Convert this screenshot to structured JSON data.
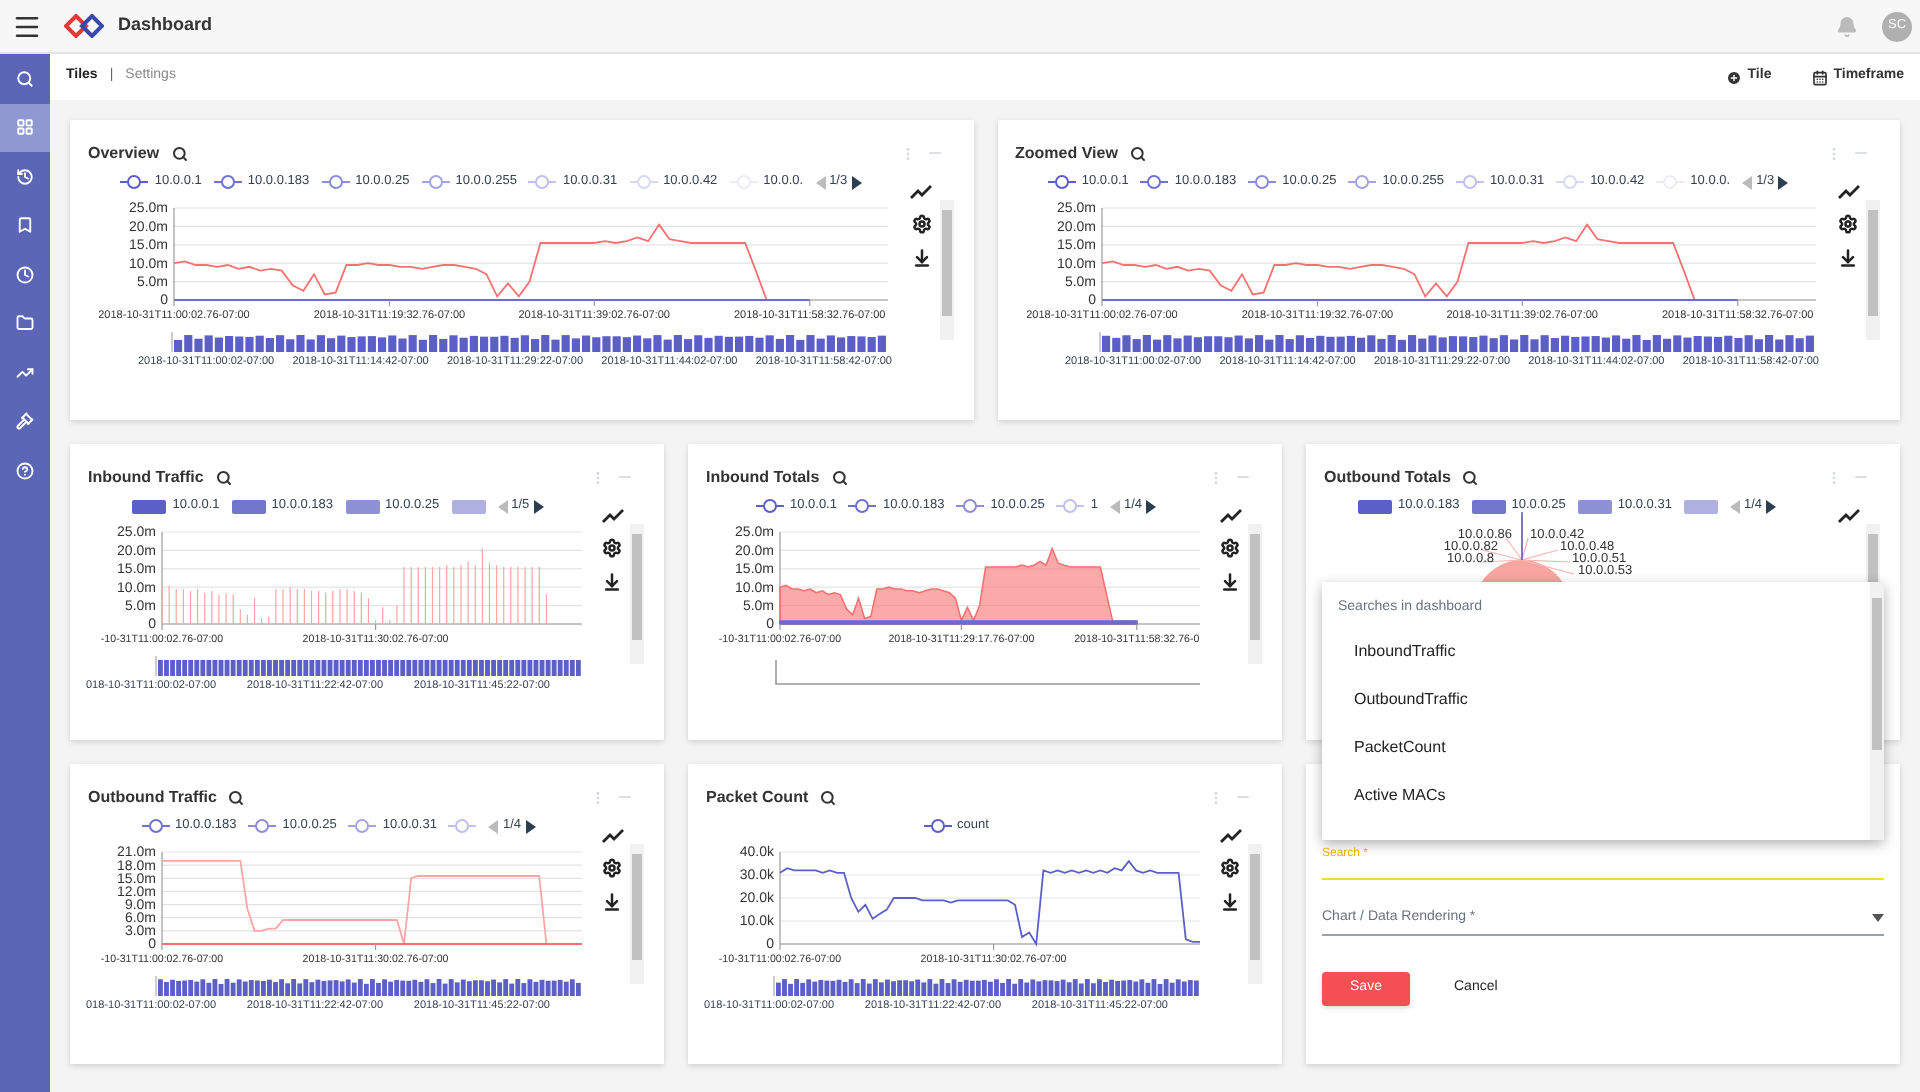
{
  "header": {
    "title": "Dashboard",
    "avatar": "SC"
  },
  "sidebar": {
    "items": [
      {
        "selected": false
      },
      {
        "selected": true
      },
      {
        "selected": false
      },
      {
        "selected": false
      },
      {
        "selected": false
      },
      {
        "selected": false
      },
      {
        "selected": false
      },
      {
        "selected": false
      },
      {
        "selected": false
      }
    ]
  },
  "tabs": [
    {
      "label": "Tiles",
      "selected": true
    },
    {
      "label": "Settings",
      "selected": false
    }
  ],
  "tab_separator": "|",
  "actions": [
    {
      "label": "Tile"
    },
    {
      "label": "Timeframe"
    }
  ],
  "tiles": [
    {
      "kind": "chart",
      "title": "Overview",
      "legend": {
        "kind": "line",
        "items": [
          {
            "label": "10.0.0.1",
            "color": "#5c5fc8"
          },
          {
            "label": "10.0.0.183",
            "color": "#6f72d0"
          },
          {
            "label": "10.0.0.25",
            "color": "#8b8dd9"
          },
          {
            "label": "10.0.0.255",
            "color": "#a3a5e2"
          },
          {
            "label": "10.0.0.31",
            "color": "#bfc0eb"
          },
          {
            "label": "10.0.0.42",
            "color": "#d8d9f2"
          },
          {
            "label": "10.0.0.",
            "color": "#ececf8"
          }
        ],
        "page": "1/3"
      },
      "chart_data": {
        "type": "line",
        "grid": true,
        "ylim": [
          0,
          25
        ],
        "yticks": [
          {
            "value": 0,
            "label": "0"
          },
          {
            "value": 5,
            "label": "5.0m"
          },
          {
            "value": 10,
            "label": "10.0m"
          },
          {
            "value": 15,
            "label": "15.0m"
          },
          {
            "value": 20,
            "label": "20.0m"
          },
          {
            "value": 25,
            "label": "25.0m"
          }
        ],
        "categories": [
          "2018-10-31T11:00:02.76-07:00",
          null,
          null,
          null,
          null,
          null,
          null,
          null,
          null,
          null,
          null,
          null,
          null,
          null,
          null,
          null,
          null,
          null,
          null,
          null,
          "2018-10-31T11:19:32.76-07:00",
          null,
          null,
          null,
          null,
          null,
          null,
          null,
          null,
          null,
          null,
          null,
          null,
          null,
          null,
          null,
          null,
          null,
          null,
          "2018-10-31T11:39:02.76-07:00",
          null,
          null,
          null,
          null,
          null,
          null,
          null,
          null,
          null,
          null,
          null,
          null,
          null,
          null,
          null,
          null,
          null,
          null,
          null,
          "2018-10-31T11:58:32.76-07:00"
        ],
        "series": [
          {
            "color": "#f87171",
            "values": [
              10,
              10.5,
              9.5,
              9.5,
              9,
              9.5,
              8.5,
              9,
              8,
              8.5,
              8,
              4,
              2.5,
              7,
              1.5,
              2,
              9.5,
              9.5,
              10,
              9.5,
              9.5,
              9,
              9,
              8.5,
              9,
              9.5,
              9.5,
              9,
              8.5,
              7,
              1,
              4.5,
              1,
              5,
              15.5,
              15.5,
              15.5,
              15.5,
              15.5,
              15.5,
              16,
              15.5,
              16,
              17,
              16,
              20.5,
              16.5,
              16,
              15.5,
              15.5,
              15.5,
              15.5,
              15.5,
              15.5,
              8,
              0,
              null,
              null,
              null,
              null
            ]
          },
          {
            "color": "#6b6bd6",
            "values": [
              0,
              0,
              0,
              0,
              0,
              0,
              0,
              0,
              0,
              0,
              0,
              0,
              0,
              0,
              0,
              0,
              0,
              0,
              0,
              0,
              0,
              0,
              0,
              0,
              0,
              0,
              0,
              0,
              0,
              0,
              0,
              0,
              0,
              0,
              0,
              0,
              0,
              0,
              0,
              0,
              0,
              0,
              0,
              0,
              0,
              0,
              0,
              0,
              0,
              0,
              0,
              0,
              0,
              0,
              0,
              0,
              0,
              0,
              0,
              0
            ]
          }
        ]
      },
      "brush": {
        "kind": "bars",
        "labels": [
          "2018-10-31T11:00:02-07:00",
          "2018-10-31T11:14:42-07:00",
          "2018-10-31T11:29:22-07:00",
          "2018-10-31T11:44:02-07:00",
          "2018-10-31T11:58:42-07:00"
        ]
      }
    },
    {
      "kind": "chart",
      "title": "Zoomed View",
      "legend": {
        "kind": "line",
        "items": [
          {
            "label": "10.0.0.1",
            "color": "#5c5fc8"
          },
          {
            "label": "10.0.0.183",
            "color": "#6f72d0"
          },
          {
            "label": "10.0.0.25",
            "color": "#8b8dd9"
          },
          {
            "label": "10.0.0.255",
            "color": "#a3a5e2"
          },
          {
            "label": "10.0.0.31",
            "color": "#bfc0eb"
          },
          {
            "label": "10.0.0.42",
            "color": "#d8d9f2"
          },
          {
            "label": "10.0.0.",
            "color": "#ececf8"
          }
        ],
        "page": "1/3"
      },
      "chart_data": {
        "type": "line",
        "grid": true,
        "ylim": [
          0,
          25
        ],
        "yticks": [
          {
            "value": 0,
            "label": "0"
          },
          {
            "value": 5,
            "label": "5.0m"
          },
          {
            "value": 10,
            "label": "10.0m"
          },
          {
            "value": 15,
            "label": "15.0m"
          },
          {
            "value": 20,
            "label": "20.0m"
          },
          {
            "value": 25,
            "label": "25.0m"
          }
        ],
        "categories": [
          "2018-10-31T11:00:02.76-07:00",
          null,
          null,
          null,
          null,
          null,
          null,
          null,
          null,
          null,
          null,
          null,
          null,
          null,
          null,
          null,
          null,
          null,
          null,
          null,
          "2018-10-31T11:19:32.76-07:00",
          null,
          null,
          null,
          null,
          null,
          null,
          null,
          null,
          null,
          null,
          null,
          null,
          null,
          null,
          null,
          null,
          null,
          null,
          "2018-10-31T11:39:02.76-07:00",
          null,
          null,
          null,
          null,
          null,
          null,
          null,
          null,
          null,
          null,
          null,
          null,
          null,
          null,
          null,
          null,
          null,
          null,
          null,
          "2018-10-31T11:58:32.76-07:00"
        ],
        "series": [
          {
            "color": "#f87171",
            "values": [
              10,
              10.5,
              9.5,
              9.5,
              9,
              9.5,
              8.5,
              9,
              8,
              8.5,
              8,
              4,
              2.5,
              7,
              1.5,
              2,
              9.5,
              9.5,
              10,
              9.5,
              9.5,
              9,
              9,
              8.5,
              9,
              9.5,
              9.5,
              9,
              8.5,
              7,
              1,
              4.5,
              1,
              5,
              15.5,
              15.5,
              15.5,
              15.5,
              15.5,
              15.5,
              16,
              15.5,
              16,
              17,
              16,
              20.5,
              16.5,
              16,
              15.5,
              15.5,
              15.5,
              15.5,
              15.5,
              15.5,
              8,
              0,
              null,
              null,
              null,
              null
            ]
          },
          {
            "color": "#6b6bd6",
            "values": [
              0,
              0,
              0,
              0,
              0,
              0,
              0,
              0,
              0,
              0,
              0,
              0,
              0,
              0,
              0,
              0,
              0,
              0,
              0,
              0,
              0,
              0,
              0,
              0,
              0,
              0,
              0,
              0,
              0,
              0,
              0,
              0,
              0,
              0,
              0,
              0,
              0,
              0,
              0,
              0,
              0,
              0,
              0,
              0,
              0,
              0,
              0,
              0,
              0,
              0,
              0,
              0,
              0,
              0,
              0,
              0,
              0,
              0,
              0,
              0
            ]
          }
        ]
      },
      "brush": {
        "kind": "bars",
        "labels": [
          "2018-10-31T11:00:02-07:00",
          "2018-10-31T11:14:42-07:00",
          "2018-10-31T11:29:22-07:00",
          "2018-10-31T11:44:02-07:00",
          "2018-10-31T11:58:42-07:00"
        ]
      }
    },
    {
      "kind": "chart",
      "title": "Inbound Traffic",
      "legend": {
        "kind": "bar",
        "items": [
          {
            "label": "10.0.0.1",
            "color": "#5c5fc8"
          },
          {
            "label": "10.0.0.183",
            "color": "#7275cc"
          },
          {
            "label": "10.0.0.25",
            "color": "#8f91d6"
          },
          {
            "color": "#aeb0e0"
          }
        ],
        "page": "1/5"
      },
      "chart_data": {
        "type": "bar",
        "grid": true,
        "ylim": [
          0,
          25
        ],
        "yticks": [
          {
            "value": 0,
            "label": "0"
          },
          {
            "value": 5,
            "label": "5.0m"
          },
          {
            "value": 10,
            "label": "10.0m"
          },
          {
            "value": 15,
            "label": "15.0m"
          },
          {
            "value": 20,
            "label": "20.0m"
          },
          {
            "value": 25,
            "label": "25.0m"
          }
        ],
        "categories": [
          "-10-31T11:00:02.76-07:00",
          null,
          null,
          null,
          null,
          null,
          null,
          null,
          null,
          null,
          null,
          null,
          null,
          null,
          null,
          null,
          null,
          null,
          null,
          null,
          null,
          null,
          null,
          null,
          null,
          null,
          null,
          null,
          null,
          null,
          "2018-10-31T11:30:02.76-07:00",
          null,
          null,
          null,
          null,
          null,
          null,
          null,
          null,
          null,
          null,
          null,
          null,
          null,
          null,
          null,
          null,
          null,
          null,
          null,
          null,
          null,
          null,
          null,
          null,
          null,
          null,
          null,
          null,
          null
        ],
        "series": [
          {
            "color": "#fca5a5",
            "values": [
              10,
              10.5,
              9.5,
              9.5,
              9,
              9.5,
              8.5,
              9,
              8,
              8.5,
              8,
              4,
              2.5,
              7,
              1.5,
              2,
              9.5,
              9.5,
              10,
              9.5,
              9.5,
              9,
              9,
              8.5,
              9,
              9.5,
              9.5,
              9,
              8.5,
              7,
              1,
              4.5,
              1,
              5,
              15.5,
              15.5,
              15.5,
              15.5,
              15.5,
              15.5,
              16,
              15.5,
              16,
              17,
              16,
              20.5,
              16.5,
              16,
              15.5,
              15.5,
              15.5,
              15.5,
              15.5,
              15.5,
              8,
              0,
              0,
              0,
              0,
              0
            ]
          }
        ]
      },
      "brush": {
        "kind": "bars",
        "labels": [
          "018-10-31T11:00:02-07:00",
          "2018-10-31T11:22:42-07:00",
          "2018-10-31T11:45:22-07:00"
        ]
      }
    },
    {
      "kind": "chart",
      "title": "Inbound Totals",
      "legend": {
        "kind": "line",
        "items": [
          {
            "label": "10.0.0.1",
            "color": "#5c5fc8"
          },
          {
            "label": "10.0.0.183",
            "color": "#6f72d0"
          },
          {
            "label": "10.0.0.25",
            "color": "#8b8dd9"
          },
          {
            "label": "1",
            "color": "#bfc0eb"
          }
        ],
        "page": "1/4"
      },
      "chart_data": {
        "type": "area",
        "grid": true,
        "ylim": [
          0,
          25
        ],
        "yticks": [
          {
            "value": 0,
            "label": "0"
          },
          {
            "value": 5,
            "label": "5.0m"
          },
          {
            "value": 10,
            "label": "10.0m"
          },
          {
            "value": 15,
            "label": "15.0m"
          },
          {
            "value": 20,
            "label": "20.0m"
          },
          {
            "value": 25,
            "label": "25.0m"
          }
        ],
        "categories": [
          "-10-31T11:00:02.76-07:00",
          null,
          null,
          null,
          null,
          null,
          null,
          null,
          null,
          null,
          null,
          null,
          null,
          null,
          null,
          null,
          null,
          null,
          null,
          null,
          null,
          null,
          null,
          null,
          null,
          null,
          null,
          null,
          null,
          null,
          "2018-10-31T11:29:17.76-07:00",
          null,
          null,
          null,
          null,
          null,
          null,
          null,
          null,
          null,
          null,
          null,
          null,
          null,
          null,
          null,
          null,
          null,
          null,
          null,
          null,
          null,
          null,
          null,
          null,
          null,
          null,
          null,
          null,
          "2018-10-31T11:58:32.76-0"
        ],
        "series": [
          {
            "color": "#f87171",
            "values": [
              10,
              10.5,
              9.5,
              9.5,
              9,
              9.5,
              8.5,
              9,
              8,
              8.5,
              8,
              4,
              2.5,
              7,
              1.5,
              2,
              9.5,
              9.5,
              10,
              9.5,
              9.5,
              9,
              9,
              8.5,
              9,
              9.5,
              9.5,
              9,
              8.5,
              7,
              1,
              4.5,
              1,
              5,
              15.5,
              15.5,
              15.5,
              15.5,
              15.5,
              15.5,
              16,
              15.5,
              16,
              17,
              16,
              20.5,
              16.5,
              16,
              15.5,
              15.5,
              15.5,
              15.5,
              15.5,
              15.5,
              8,
              0,
              0,
              0,
              0,
              0
            ]
          },
          {
            "color": "#6b6bd6",
            "values": [
              0,
              0,
              0,
              0,
              0,
              0,
              0,
              0,
              0,
              0,
              0,
              0,
              0,
              0,
              0,
              0,
              0,
              0,
              0,
              0,
              0,
              0,
              0,
              0,
              0,
              0,
              0,
              0,
              0,
              0,
              0,
              0,
              0,
              0,
              0,
              0,
              0,
              0,
              0,
              0,
              0,
              0,
              0,
              0,
              0,
              0,
              0,
              0,
              0,
              0,
              0,
              0,
              0,
              0,
              0,
              0,
              0,
              0,
              0,
              0
            ]
          }
        ]
      },
      "brush": {
        "kind": "empty"
      }
    },
    {
      "kind": "pie",
      "title": "Outbound Totals",
      "legend": {
        "kind": "bar",
        "items": [
          {
            "label": "10.0.0.183",
            "color": "#5c5fc8"
          },
          {
            "label": "10.0.0.25",
            "color": "#7275cc"
          },
          {
            "label": "10.0.0.31",
            "color": "#8f91d6"
          },
          {
            "color": "#aeb0e0"
          }
        ],
        "page": "1/4"
      },
      "slice_labels": [
        "10.0.0.86",
        "10.0.0.82",
        "10.0.0.8",
        "10.0.0.42",
        "10.0.0.48",
        "10.0.0.51",
        "10.0.0.53"
      ]
    },
    {
      "kind": "chart",
      "title": "Outbound Traffic",
      "legend": {
        "kind": "line",
        "items": [
          {
            "label": "10.0.0.183",
            "color": "#6f72d0"
          },
          {
            "label": "10.0.0.25",
            "color": "#8b8dd9"
          },
          {
            "label": "10.0.0.31",
            "color": "#a3a5e2"
          },
          {
            "color": "#bfc0eb"
          }
        ],
        "page": "1/4"
      },
      "chart_data": {
        "type": "line",
        "grid": true,
        "ylim": [
          0,
          21
        ],
        "yticks": [
          {
            "value": 0,
            "label": "0"
          },
          {
            "value": 3,
            "label": "3.0m"
          },
          {
            "value": 6,
            "label": "6.0m"
          },
          {
            "value": 9,
            "label": "9.0m"
          },
          {
            "value": 12,
            "label": "12.0m"
          },
          {
            "value": 15,
            "label": "15.0m"
          },
          {
            "value": 18,
            "label": "18.0m"
          },
          {
            "value": 21,
            "label": "21.0m"
          }
        ],
        "categories": [
          "-10-31T11:00:02.76-07:00",
          null,
          null,
          null,
          null,
          null,
          null,
          null,
          null,
          null,
          null,
          null,
          null,
          null,
          null,
          null,
          null,
          null,
          null,
          null,
          null,
          null,
          null,
          null,
          null,
          null,
          null,
          null,
          null,
          null,
          "2018-10-31T11:30:02.76-07:00",
          null,
          null,
          null,
          null,
          null,
          null,
          null,
          null,
          null,
          null,
          null,
          null,
          null,
          null,
          null,
          null,
          null,
          null,
          null,
          null,
          null,
          null,
          null,
          null,
          null,
          null,
          null,
          null,
          null
        ],
        "series": [
          {
            "color": "#fca5a5",
            "values": [
              19,
              19,
              19,
              19,
              19,
              19,
              19,
              19,
              19,
              19,
              19,
              19,
              8,
              3,
              3,
              3.5,
              3.5,
              5.5,
              5.5,
              5.5,
              5.5,
              5.5,
              5.5,
              5.5,
              5.5,
              5.5,
              5.5,
              5.5,
              5.5,
              5.5,
              5.5,
              5.5,
              5.5,
              5.5,
              0,
              15,
              15.5,
              15.5,
              15.5,
              15.5,
              15.5,
              15.5,
              15.5,
              15.5,
              15.5,
              15.5,
              15.5,
              15.5,
              15.5,
              15.5,
              15.5,
              15.5,
              15.5,
              15.5,
              0,
              null,
              null,
              null,
              null,
              null
            ]
          },
          {
            "color": "#f87171",
            "values": [
              0,
              0,
              0,
              0,
              0,
              0,
              0,
              0,
              0,
              0,
              0,
              0,
              0,
              0,
              0,
              0,
              0,
              0,
              0,
              0,
              0,
              0,
              0,
              0,
              0,
              0,
              0,
              0,
              0,
              0,
              0,
              0,
              0,
              0,
              0,
              0,
              0,
              0,
              0,
              0,
              0,
              0,
              0,
              0,
              0,
              0,
              0,
              0,
              0,
              0,
              0,
              0,
              0,
              0,
              0,
              0,
              0,
              0,
              0,
              0
            ]
          }
        ]
      },
      "brush": {
        "kind": "bars",
        "labels": [
          "018-10-31T11:00:02-07:00",
          "2018-10-31T11:22:42-07:00",
          "2018-10-31T11:45:22-07:00"
        ]
      }
    },
    {
      "kind": "chart",
      "title": "Packet Count",
      "legend": {
        "kind": "line",
        "items": [
          {
            "label": "count",
            "color": "#5c5fc8"
          }
        ]
      },
      "chart_data": {
        "type": "line",
        "grid": true,
        "ylim": [
          0,
          40
        ],
        "yticks": [
          {
            "value": 0,
            "label": "0"
          },
          {
            "value": 10,
            "label": "10.0k"
          },
          {
            "value": 20,
            "label": "20.0k"
          },
          {
            "value": 30,
            "label": "30.0k"
          },
          {
            "value": 40,
            "label": "40.0k"
          }
        ],
        "categories": [
          "-10-31T11:00:02.76-07:00",
          null,
          null,
          null,
          null,
          null,
          null,
          null,
          null,
          null,
          null,
          null,
          null,
          null,
          null,
          null,
          null,
          null,
          null,
          null,
          null,
          null,
          null,
          null,
          null,
          null,
          null,
          null,
          null,
          null,
          "2018-10-31T11:30:02.76-07:00",
          null,
          null,
          null,
          null,
          null,
          null,
          null,
          null,
          null,
          null,
          null,
          null,
          null,
          null,
          null,
          null,
          null,
          null,
          null,
          null,
          null,
          null,
          null,
          null,
          null,
          null,
          null,
          null,
          null
        ],
        "series": [
          {
            "color": "#5c5fc8",
            "values": [
              31,
              33,
              32,
              32,
              32,
              32,
              31,
              32,
              31,
              31,
              20,
              14,
              17,
              11,
              13,
              15,
              20,
              20,
              20,
              20,
              19,
              19,
              19,
              19,
              18,
              19,
              19,
              19,
              19,
              19,
              19,
              19,
              19,
              17,
              3,
              5,
              0,
              32,
              31,
              32,
              31,
              32,
              31,
              32,
              31,
              32,
              31,
              33,
              32,
              36,
              32,
              31,
              32,
              31,
              31,
              31,
              31,
              2,
              1,
              1
            ]
          }
        ]
      },
      "brush": {
        "kind": "bars",
        "labels": [
          "018-10-31T11:00:02-07:00",
          "2018-10-31T11:22:42-07:00",
          "2018-10-31T11:45:22-07:00"
        ]
      }
    },
    {
      "kind": "form",
      "search_label": "Search *",
      "select_label": "Chart / Data Rendering *",
      "buttons": [
        {
          "label": "Save",
          "kind": "primary"
        },
        {
          "label": "Cancel",
          "kind": "plain"
        }
      ]
    }
  ],
  "dropdown": {
    "heading": "Searches in dashboard",
    "items": [
      "InboundTraffic",
      "OutboundTraffic",
      "PacketCount",
      "Active MACs"
    ]
  }
}
